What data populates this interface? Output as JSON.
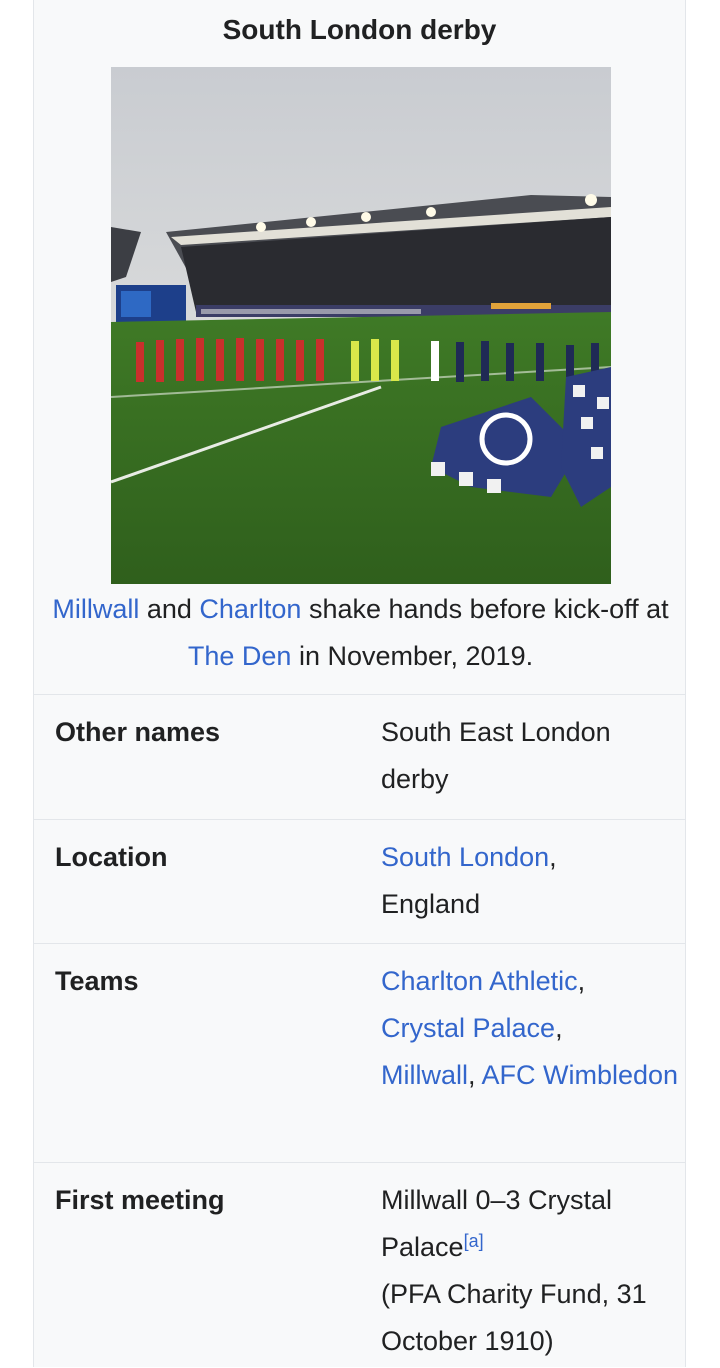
{
  "infobox": {
    "title": "South London derby",
    "image_alt": "Millwall and Charlton players lined up on the pitch at The Den",
    "caption": {
      "link_millwall": "Millwall",
      "text_and": " and ",
      "link_charlton": "Charlton",
      "text_middle": " shake hands before kick-off at ",
      "link_den": "The Den",
      "text_end": " in November, 2019."
    },
    "rows": {
      "other_names": {
        "label": "Other names",
        "value": "South East London derby"
      },
      "location": {
        "label": "Location",
        "link": "South London",
        "sep": ",",
        "text": "England"
      },
      "teams": {
        "label": "Teams",
        "charlton": "Charlton Athletic",
        "sep1": ",",
        "palace": "Crystal Palace",
        "sep2": ",",
        "millwall": "Millwall",
        "sep3": ", ",
        "afc": "AFC Wimbledon"
      },
      "first_meeting": {
        "label": "First meeting",
        "result": "Millwall 0–3 Crystal Palace",
        "note": "[a]",
        "details": "(PFA Charity Fund, 31 October 1910)"
      }
    }
  },
  "colors": {
    "link": "#3366cc",
    "text": "#202122",
    "background": "#f8f9fa",
    "border": "#e3e6ea"
  }
}
